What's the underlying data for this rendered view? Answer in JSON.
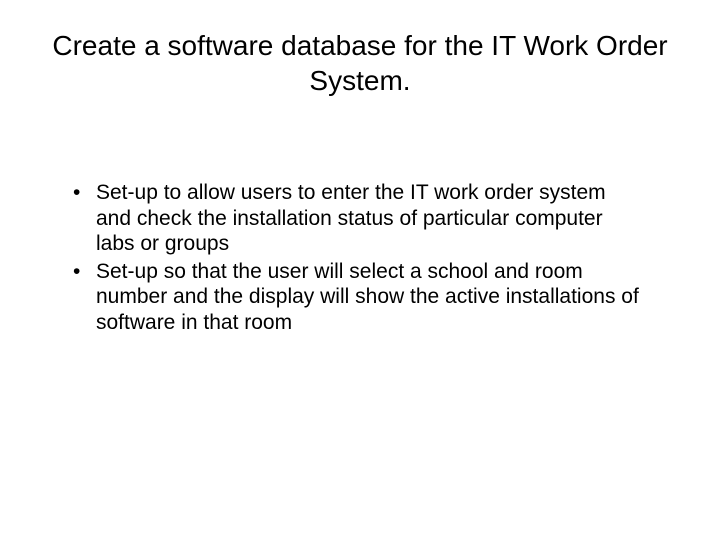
{
  "slide": {
    "title": "Create a software database for the IT Work Order System.",
    "bullets": [
      "Set-up to allow users to enter the IT work order system and check the installation status of particular computer labs or groups",
      "Set-up so that the user will select a school and room number and the display will show the active installations of software in that room"
    ]
  }
}
